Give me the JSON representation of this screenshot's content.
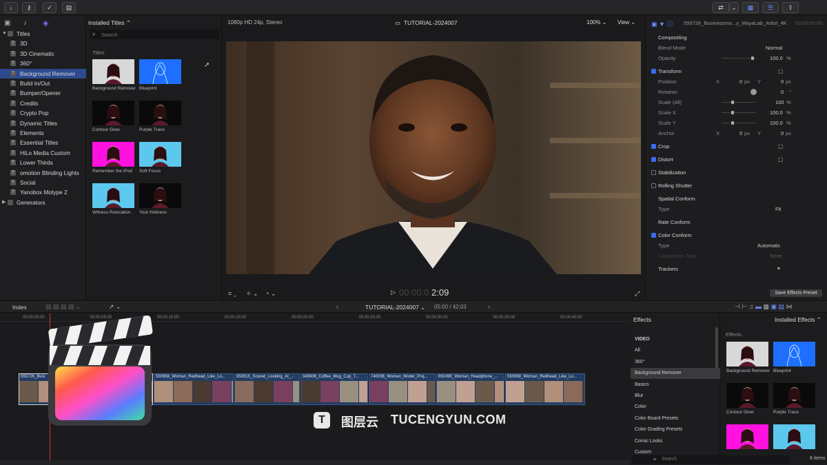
{
  "toolbar": {
    "icons": [
      "import-arrow-icon",
      "key-icon",
      "checkmark-icon",
      "photo-library-icon"
    ],
    "right_icons": [
      "toggle-switch-icon",
      "chevron-icon",
      "grid-view-icon",
      "list-view-icon",
      "share-icon"
    ]
  },
  "library": {
    "items": [
      {
        "label": "Titles",
        "level": 0,
        "expanded": true
      },
      {
        "label": "3D"
      },
      {
        "label": "3D Cinematic"
      },
      {
        "label": "360°"
      },
      {
        "label": "Background Remover",
        "selected": true
      },
      {
        "label": "Build In/Out"
      },
      {
        "label": "Bumper/Opener"
      },
      {
        "label": "Credits"
      },
      {
        "label": "Crypto Pop"
      },
      {
        "label": "Dynamic Titles"
      },
      {
        "label": "Elements"
      },
      {
        "label": "Essential Titles"
      },
      {
        "label": "HiLo Media Custom"
      },
      {
        "label": "Lower Thirds"
      },
      {
        "label": "omotion Blinding Lights"
      },
      {
        "label": "Social"
      },
      {
        "label": "Yanobox Motype 2"
      },
      {
        "label": "Generators",
        "level": 0,
        "expanded": false
      }
    ]
  },
  "browser": {
    "header": "Installed Titles",
    "search_placeholder": "Search",
    "section": "Titles",
    "thumbs": [
      {
        "label": "Background Remover",
        "color": "#d8d8d8"
      },
      {
        "label": "Blueprint",
        "color": "#1e6fff"
      },
      {
        "label": "Contour Glow",
        "color": "#0a0a0a"
      },
      {
        "label": "Purple Trace",
        "color": "#0a0a0a"
      },
      {
        "label": "Remember the iPod",
        "color": "#ff11e0"
      },
      {
        "label": "Soft Focus",
        "color": "#5cc8ee"
      },
      {
        "label": "Witness Relocation",
        "color": "#5cc8ee"
      },
      {
        "label": "Your Holiness",
        "color": "#0a0a0a"
      }
    ]
  },
  "viewer": {
    "format": "1080p HD 24p, Stereo",
    "project": "TUTORIAL-2024007",
    "zoom": "100%",
    "view": "View",
    "timecode_dim": "00:00:0",
    "timecode": "2:09"
  },
  "inspector": {
    "title": "555726_Businessma...y_MayaLab_Artist_4K",
    "duration": "00:00:05:00",
    "compositing": "Compositing",
    "blend_label": "Blend Mode",
    "blend_value": "Normal",
    "opacity_label": "Opacity",
    "opacity": "100.0",
    "opacity_pct": 0.9,
    "transform": "Transform",
    "position_label": "Position",
    "x": "X",
    "y": "Y",
    "pos_x": "0",
    "pos_y": "0",
    "px": "px",
    "rotation_label": "Rotation",
    "rotation": "0",
    "deg": "°",
    "scale_all_label": "Scale (All)",
    "scale_all": "100",
    "scale_x_label": "Scale X",
    "scale_x": "100.0",
    "scale_y_label": "Scale Y",
    "scale_y": "100.0",
    "pct": "%",
    "anchor_label": "Anchor",
    "anchor_x": "0",
    "anchor_y": "0",
    "crop": "Crop",
    "distort": "Distort",
    "stabilization": "Stabilization",
    "rolling": "Rolling Shutter",
    "spatial": "Spatial Conform",
    "type_label": "Type",
    "type_value": "Fit",
    "rate": "Rate Conform",
    "color_conform": "Color Conform",
    "color_type": "Automatic",
    "conversion_label": "Conversion Type",
    "conversion_value": "None",
    "trackers": "Trackers",
    "plus": "+",
    "save": "Save Effects Preset"
  },
  "timeline": {
    "index": "Index",
    "project": "TUTORIAL-2024007",
    "duration": "05:00 / 42:03",
    "ruler": [
      "00:00:00:00",
      "00:00:05:00",
      "00:00:10:00",
      "00:00:15:00",
      "00:00:20:00",
      "00:00:25:00",
      "00:00:30:00",
      "00:00:35:00",
      "00:00:40:00"
    ],
    "clips": [
      {
        "name": "555726_Busi"
      },
      {
        "name": "550958_Woman_Redhead_Like_Lo..."
      },
      {
        "name": "550915_Scared_Looking_At_..."
      },
      {
        "name": "345606_Coffee_Mug_Cup_T..."
      },
      {
        "name": "740036_Woman_Model_Proj..."
      },
      {
        "name": "692490_Woman_Headphone_..."
      },
      {
        "name": "550958_Woman_Redhead_Like_Lo..."
      }
    ]
  },
  "watermark": {
    "cn": "图层云",
    "en": "TUCENGYUN.COM"
  },
  "effects": {
    "title": "Effects",
    "items": [
      "VIDEO",
      "All",
      "360°",
      "Background Remover",
      "Basics",
      "Blur",
      "Color",
      "Color Board Presets",
      "Color Grading Presets",
      "Comic Looks",
      "Custom"
    ],
    "selected": 3
  },
  "effects_browser": {
    "header": "Installed Effects",
    "section": "Effects",
    "thumbs": [
      {
        "label": "Background Remover",
        "color": "#d8d8d8"
      },
      {
        "label": "Blueprint",
        "color": "#1e6fff"
      },
      {
        "label": "Contour Glow",
        "color": "#0a0a0a"
      },
      {
        "label": "Purple Trace",
        "color": "#0a0a0a"
      },
      {
        "label": "",
        "color": "#ff11e0"
      },
      {
        "label": "",
        "color": "#5cc8ee"
      }
    ],
    "search_placeholder": "Search",
    "count": "8 items"
  }
}
